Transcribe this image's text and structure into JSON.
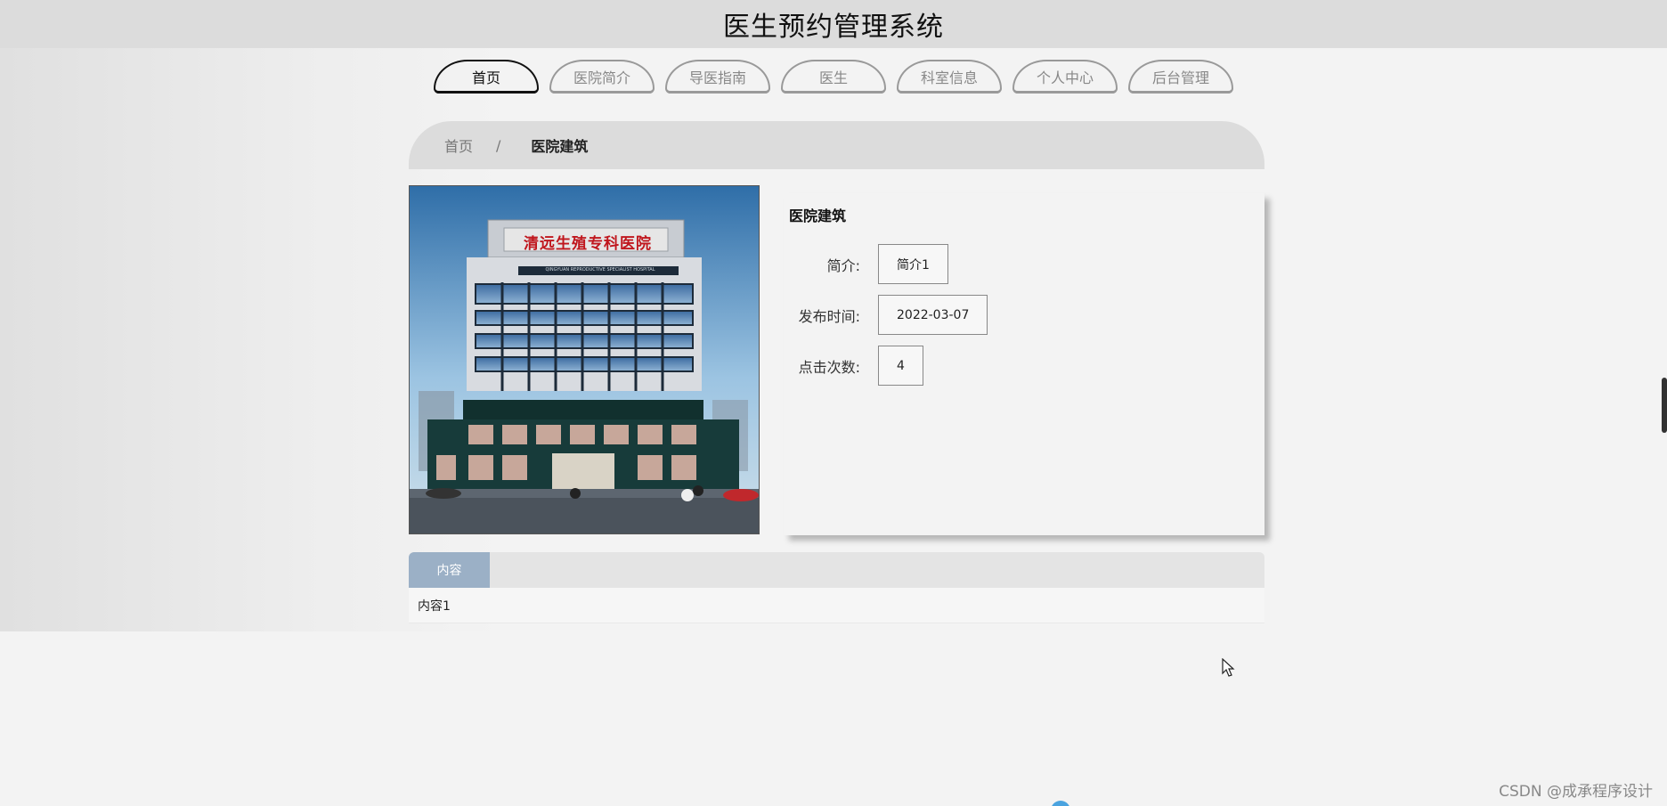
{
  "header": {
    "title": "医生预约管理系统"
  },
  "nav": {
    "items": [
      {
        "label": "首页",
        "active": true
      },
      {
        "label": "医院简介"
      },
      {
        "label": "导医指南"
      },
      {
        "label": "医生"
      },
      {
        "label": "科室信息"
      },
      {
        "label": "个人中心"
      },
      {
        "label": "后台管理"
      }
    ]
  },
  "breadcrumb": {
    "home": "首页",
    "separator": "/",
    "current": "医院建筑"
  },
  "detail": {
    "title": "医院建筑",
    "fields": [
      {
        "label": "简介:",
        "value": "简介1"
      },
      {
        "label": "发布时间:",
        "value": "2022-03-07"
      },
      {
        "label": "点击次数:",
        "value": "4"
      }
    ]
  },
  "photo": {
    "sign_text": "清远生殖专科医院",
    "sign_subtext": "QINGYUAN REPRODUCTIVE SPECIALIST HOSPITAL"
  },
  "tabs": {
    "active_label": "内容"
  },
  "content": {
    "text": "内容1"
  },
  "watermark": "CSDN @成承程序设计",
  "colors": {
    "tab_active": "#9bb0c6",
    "header_bg": "#dcdcdc",
    "page_bg": "#f3f3f3"
  }
}
